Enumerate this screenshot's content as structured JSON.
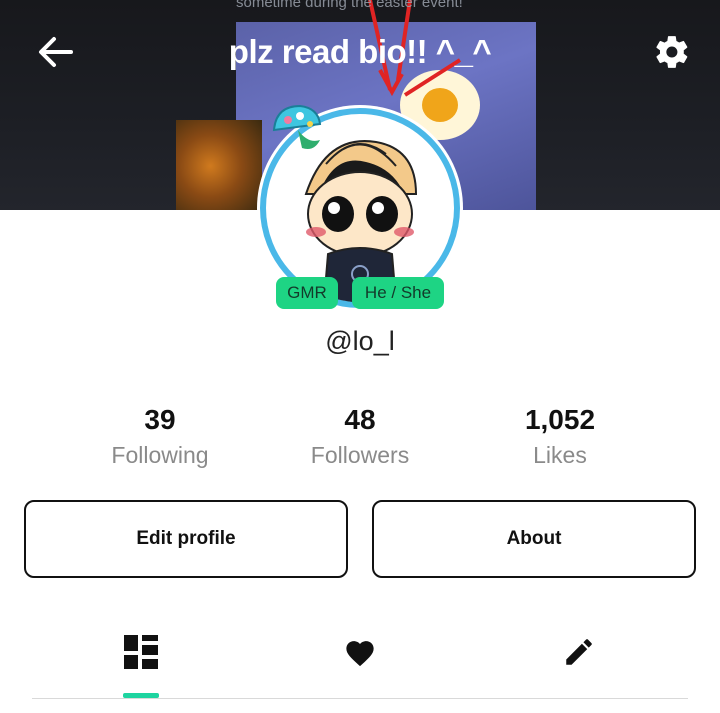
{
  "header": {
    "title": "plz read bio!! ^_^",
    "banner_caption": "sometime during the easter event!",
    "back_icon": "arrow-left-icon",
    "settings_icon": "gear-icon"
  },
  "profile": {
    "badges": [
      "GMR",
      "He / She"
    ],
    "username": "@lo_l",
    "accent_ring_color": "#4ab8e8",
    "badge_color": "#1ed484"
  },
  "stats": [
    {
      "value": "39",
      "label": "Following"
    },
    {
      "value": "48",
      "label": "Followers"
    },
    {
      "value": "1,052",
      "label": "Likes"
    }
  ],
  "actions": {
    "edit_label": "Edit profile",
    "about_label": "About"
  },
  "tabs": [
    {
      "icon": "grid-layout-icon",
      "active": true
    },
    {
      "icon": "heart-icon",
      "active": false
    },
    {
      "icon": "pencil-icon",
      "active": false
    }
  ],
  "colors": {
    "tab_indicator": "#1ed4a0"
  }
}
